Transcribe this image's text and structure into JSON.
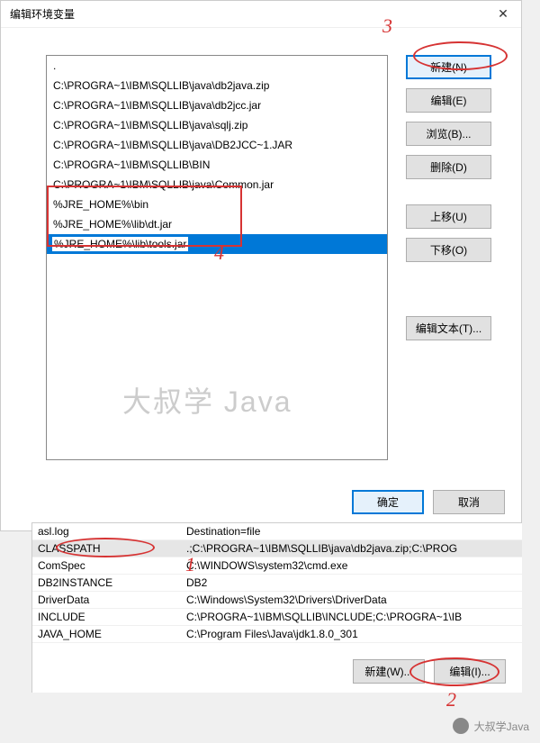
{
  "dialog": {
    "title": "编辑环境变量",
    "list": [
      ".",
      "C:\\PROGRA~1\\IBM\\SQLLIB\\java\\db2java.zip",
      "C:\\PROGRA~1\\IBM\\SQLLIB\\java\\db2jcc.jar",
      "C:\\PROGRA~1\\IBM\\SQLLIB\\java\\sqlj.zip",
      "C:\\PROGRA~1\\IBM\\SQLLIB\\java\\DB2JCC~1.JAR",
      "C:\\PROGRA~1\\IBM\\SQLLIB\\BIN",
      "C:\\PROGRA~1\\IBM\\SQLLIB\\java\\Common.jar",
      "%JRE_HOME%\\bin",
      "%JRE_HOME%\\lib\\dt.jar",
      "%JRE_HOME%\\lib\\tools.jar"
    ],
    "editing_index": 9,
    "buttons": {
      "new": "新建(N)",
      "edit": "编辑(E)",
      "browse": "浏览(B)...",
      "delete": "删除(D)",
      "moveup": "上移(U)",
      "movedown": "下移(O)",
      "edittext": "编辑文本(T)..."
    },
    "footer": {
      "ok": "确定",
      "cancel": "取消"
    }
  },
  "lower": {
    "rows": [
      {
        "name": "asl.log",
        "value": "Destination=file"
      },
      {
        "name": "CLASSPATH",
        "value": ".;C:\\PROGRA~1\\IBM\\SQLLIB\\java\\db2java.zip;C:\\PROG"
      },
      {
        "name": "ComSpec",
        "value": "C:\\WINDOWS\\system32\\cmd.exe"
      },
      {
        "name": "DB2INSTANCE",
        "value": "DB2"
      },
      {
        "name": "DriverData",
        "value": "C:\\Windows\\System32\\Drivers\\DriverData"
      },
      {
        "name": "INCLUDE",
        "value": "C:\\PROGRA~1\\IBM\\SQLLIB\\INCLUDE;C:\\PROGRA~1\\IB"
      },
      {
        "name": "JAVA_HOME",
        "value": "C:\\Program Files\\Java\\jdk1.8.0_301"
      }
    ],
    "selected_index": 1,
    "footer": {
      "new": "新建(W)...",
      "edit": "编辑(I)..."
    }
  },
  "callouts": {
    "c1": "1",
    "c2": "2",
    "c3": "3",
    "c4": "4"
  },
  "watermark": "大叔学 Java",
  "badge": "大叔学Java"
}
